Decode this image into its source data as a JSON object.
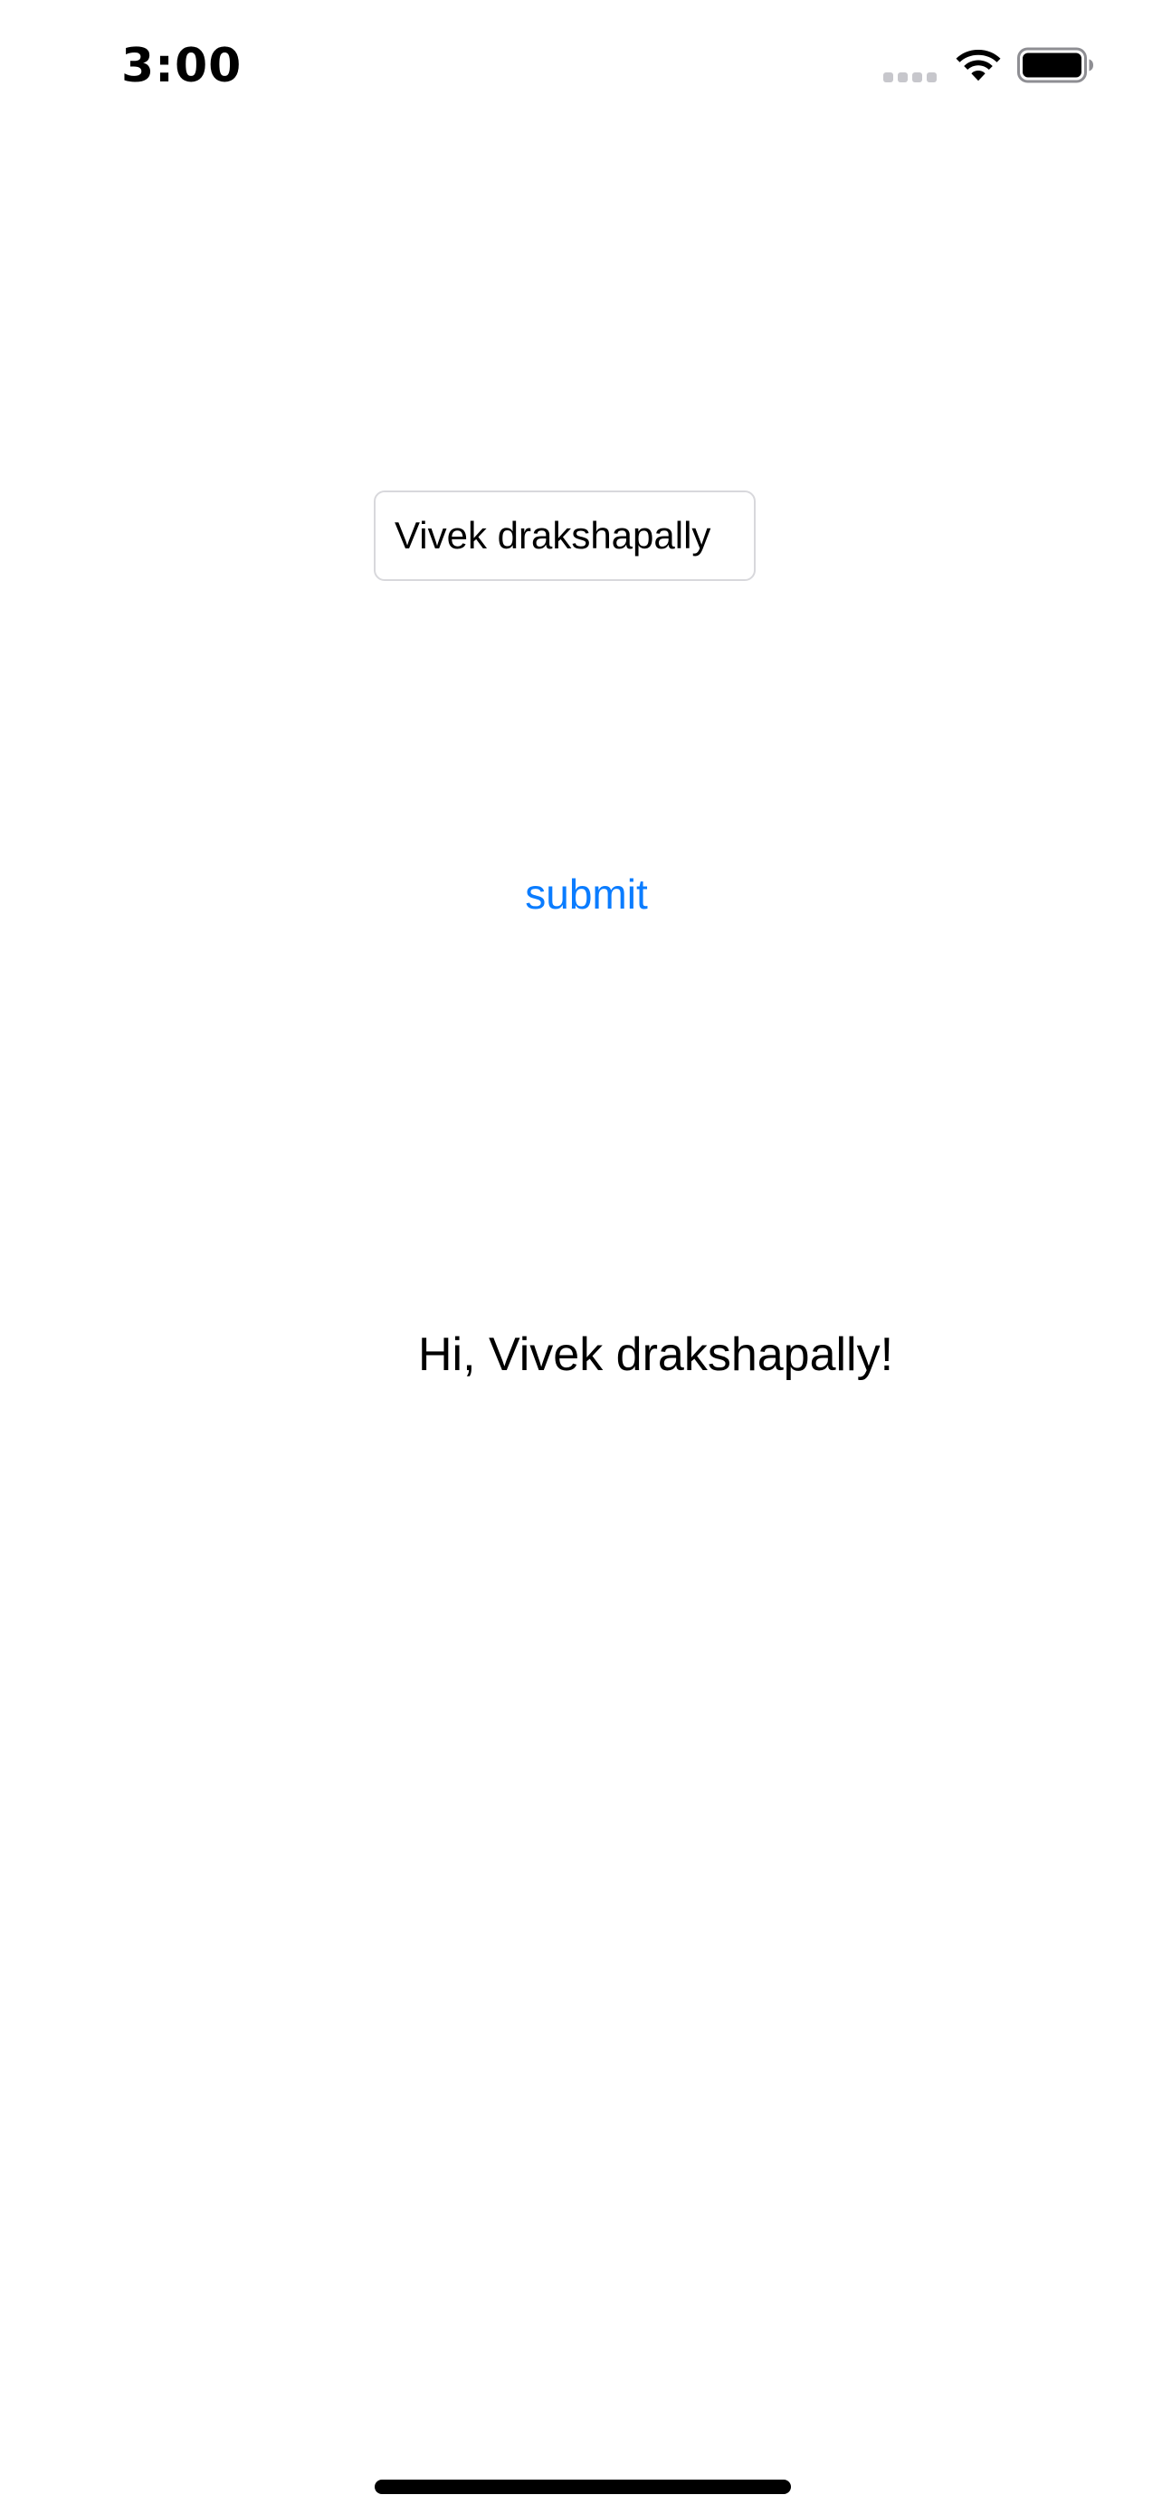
{
  "status_bar": {
    "time": "3:00",
    "signal_icon": "signal-dots-icon",
    "wifi_icon": "wifi-icon",
    "battery_icon": "battery-icon",
    "battery_level": 1.0
  },
  "form": {
    "name_value": "Vivek drakshapally",
    "submit_label": "submit"
  },
  "greeting": {
    "text": "Hi, Vivek drakshapally!"
  },
  "colors": {
    "accent": "#0a7cff",
    "text": "#000000",
    "field_border": "#d8d8dc",
    "inactive_signal": "#c7c7cc"
  }
}
